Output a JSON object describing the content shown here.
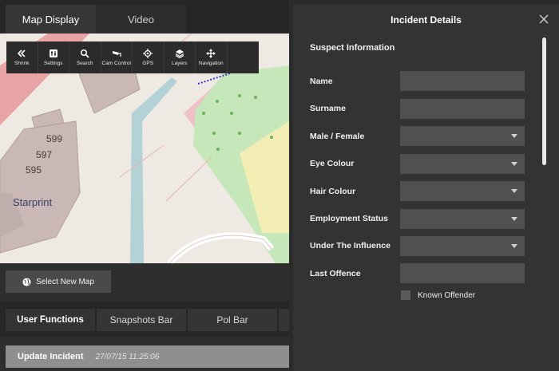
{
  "tabs": [
    {
      "label": "Map Display",
      "active": true
    },
    {
      "label": "Video",
      "active": false
    }
  ],
  "map": {
    "labels": {
      "n599": "599",
      "n597": "597",
      "n595": "595",
      "place": "Starprint"
    }
  },
  "toolbar": [
    {
      "label": "Shrink",
      "icon": "double-chevron-left-icon"
    },
    {
      "label": "Settings",
      "icon": "sliders-icon"
    },
    {
      "label": "Search",
      "icon": "search-icon"
    },
    {
      "label": "Cam Control",
      "icon": "cctv-camera-icon"
    },
    {
      "label": "GPS",
      "icon": "gps-target-icon"
    },
    {
      "label": "Layers",
      "icon": "layers-icon"
    },
    {
      "label": "Navigation",
      "icon": "move-arrows-icon"
    },
    {
      "label": "",
      "icon": ""
    }
  ],
  "select_map": {
    "label": "Select New Map",
    "icon": "globe-icon"
  },
  "functions": {
    "user": "User Functions",
    "snapshots": "Snapshots Bar",
    "pol": "Pol Bar"
  },
  "update": {
    "label": "Update Incident",
    "timestamp": "27/07/15 11:25:06"
  },
  "panel": {
    "title": "Incident Details",
    "section": "Suspect Information",
    "fields": [
      {
        "label": "Name",
        "type": "text",
        "value": ""
      },
      {
        "label": "Surname",
        "type": "text",
        "value": ""
      },
      {
        "label": "Male / Female",
        "type": "select",
        "value": ""
      },
      {
        "label": "Eye Colour",
        "type": "select",
        "value": ""
      },
      {
        "label": "Hair Colour",
        "type": "select",
        "value": ""
      },
      {
        "label": "Employment Status",
        "type": "select",
        "value": ""
      },
      {
        "label": "Under The Influence",
        "type": "select",
        "value": ""
      },
      {
        "label": "Last Offence",
        "type": "text",
        "value": ""
      }
    ],
    "known_offender": {
      "label": "Known Offender",
      "checked": false
    }
  },
  "colors": {
    "background": "#2b2b2b",
    "panel": "#333333",
    "field": "#505050",
    "accent_update": "#8f8f8f"
  }
}
